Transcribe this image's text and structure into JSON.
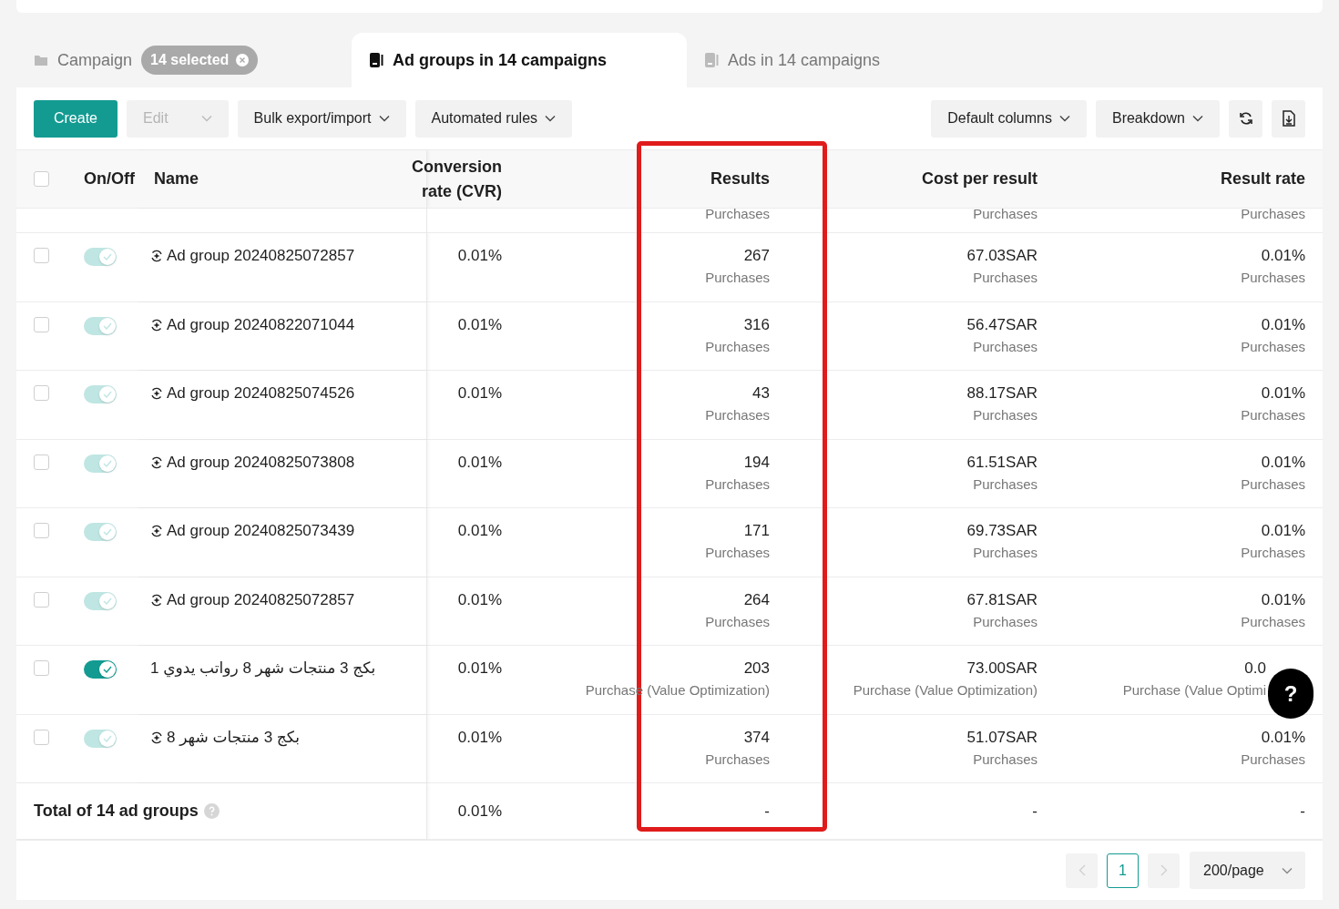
{
  "tabs": [
    {
      "kind": "filter",
      "label": "Campaign",
      "badge": "14 selected",
      "selected": false
    },
    {
      "kind": "plain",
      "label": "Ad groups in 14 campaigns",
      "selected": true
    },
    {
      "kind": "plain",
      "label": "Ads in 14 campaigns",
      "selected": false
    }
  ],
  "toolbar": {
    "left": [
      {
        "kind": "primary",
        "label": "Create",
        "disabled": false
      },
      {
        "kind": "dropdown",
        "label": "Edit",
        "disabled": true
      },
      {
        "kind": "dropdown",
        "label": "Bulk export/import",
        "disabled": false
      },
      {
        "kind": "dropdown",
        "label": "Automated rules",
        "disabled": false
      }
    ],
    "right": [
      {
        "kind": "dropdown",
        "label": "Default columns"
      },
      {
        "kind": "dropdown",
        "label": "Breakdown"
      },
      {
        "kind": "refresh"
      },
      {
        "kind": "export"
      }
    ]
  },
  "table": {
    "select_all": {
      "checked": false
    },
    "columns": [
      {
        "label": "On/Off",
        "highlighted": false
      },
      {
        "label": "Name",
        "highlighted": false
      },
      {
        "label": "Conversion rate (CVR)",
        "highlighted": false
      },
      {
        "label": "Results",
        "highlighted": true
      },
      {
        "label": "Cost per result",
        "highlighted": false
      },
      {
        "label": "Result rate",
        "highlighted": false
      }
    ],
    "partial_row": {
      "results": "Purchases",
      "cost": "Purchases",
      "rate": "Purchases"
    },
    "rows": [
      {
        "checked": false,
        "on": true,
        "disabled": true,
        "icon": true,
        "name": "Ad group 20240825072857",
        "cvr": "0.01%",
        "results": {
          "value": "267",
          "sub": "Purchases"
        },
        "cost": {
          "value": "67.03SAR",
          "sub": "Purchases"
        },
        "rate": {
          "value": "0.01%",
          "sub": "Purchases"
        }
      },
      {
        "checked": false,
        "on": true,
        "disabled": true,
        "icon": true,
        "name": "Ad group 20240822071044",
        "cvr": "0.01%",
        "results": {
          "value": "316",
          "sub": "Purchases"
        },
        "cost": {
          "value": "56.47SAR",
          "sub": "Purchases"
        },
        "rate": {
          "value": "0.01%",
          "sub": "Purchases"
        }
      },
      {
        "checked": false,
        "on": true,
        "disabled": true,
        "icon": true,
        "name": "Ad group 20240825074526",
        "cvr": "0.01%",
        "results": {
          "value": "43",
          "sub": "Purchases"
        },
        "cost": {
          "value": "88.17SAR",
          "sub": "Purchases"
        },
        "rate": {
          "value": "0.01%",
          "sub": "Purchases"
        }
      },
      {
        "checked": false,
        "on": true,
        "disabled": true,
        "icon": true,
        "name": "Ad group 20240825073808",
        "cvr": "0.01%",
        "results": {
          "value": "194",
          "sub": "Purchases"
        },
        "cost": {
          "value": "61.51SAR",
          "sub": "Purchases"
        },
        "rate": {
          "value": "0.01%",
          "sub": "Purchases"
        }
      },
      {
        "checked": false,
        "on": true,
        "disabled": true,
        "icon": true,
        "name": "Ad group 20240825073439",
        "cvr": "0.01%",
        "results": {
          "value": "171",
          "sub": "Purchases"
        },
        "cost": {
          "value": "69.73SAR",
          "sub": "Purchases"
        },
        "rate": {
          "value": "0.01%",
          "sub": "Purchases"
        }
      },
      {
        "checked": false,
        "on": true,
        "disabled": true,
        "icon": true,
        "name": "Ad group 20240825072857",
        "cvr": "0.01%",
        "results": {
          "value": "264",
          "sub": "Purchases"
        },
        "cost": {
          "value": "67.81SAR",
          "sub": "Purchases"
        },
        "rate": {
          "value": "0.01%",
          "sub": "Purchases"
        }
      },
      {
        "checked": false,
        "on": true,
        "disabled": false,
        "icon": false,
        "name": "بكج 3 منتجات شهر 8 رواتب يدوي 1",
        "cvr": "0.01%",
        "results": {
          "value": "203",
          "sub": "Purchase (Value Optimization)"
        },
        "cost": {
          "value": "73.00SAR",
          "sub": "Purchase (Value Optimization)"
        },
        "rate": {
          "value": "0.0",
          "sub": "Purchase (Value Optimi",
          "covered": true
        }
      },
      {
        "checked": false,
        "on": true,
        "disabled": true,
        "icon": true,
        "name": "بكج 3 منتجات شهر 8",
        "cvr": "0.01%",
        "results": {
          "value": "374",
          "sub": "Purchases"
        },
        "cost": {
          "value": "51.07SAR",
          "sub": "Purchases"
        },
        "rate": {
          "value": "0.01%",
          "sub": "Purchases"
        }
      }
    ],
    "total": {
      "label": "Total of 14 ad groups",
      "cvr": "0.01%",
      "results": "-",
      "cost": "-",
      "rate": "-"
    }
  },
  "pagination": {
    "prev_disabled": true,
    "pages": [
      {
        "label": "1",
        "selected": true
      }
    ],
    "next_disabled": true,
    "page_size": "200/page"
  },
  "help_button": "?"
}
